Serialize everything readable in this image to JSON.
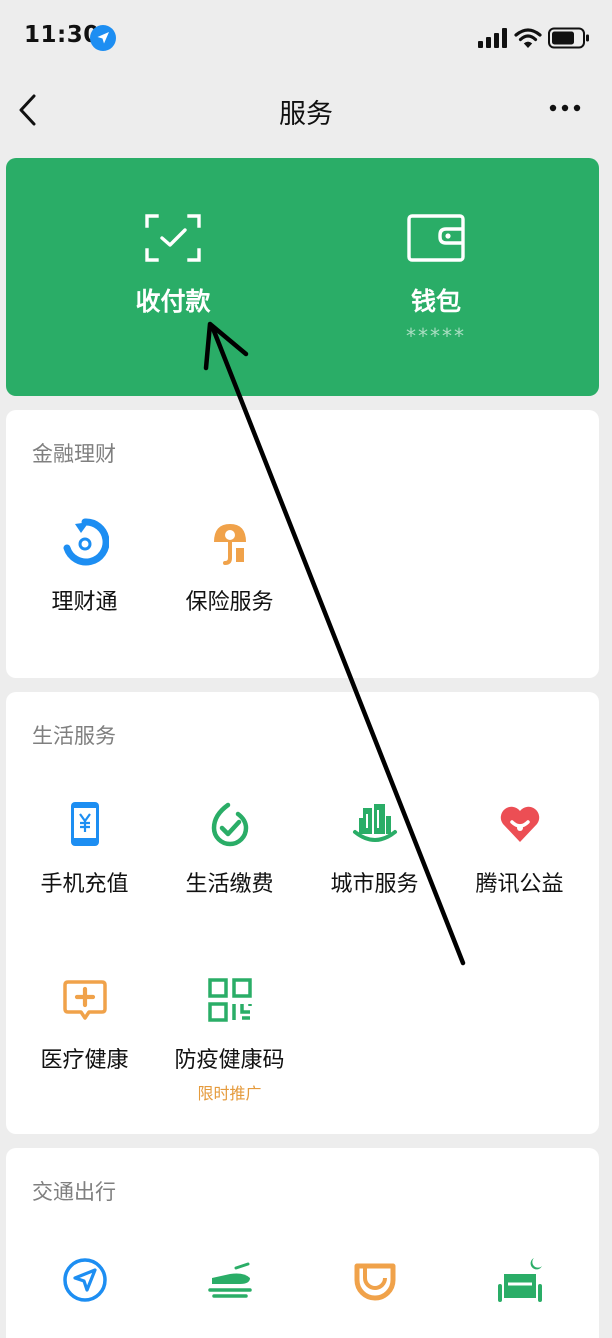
{
  "status_bar": {
    "time": "11:30"
  },
  "nav": {
    "title": "服务"
  },
  "wallet_card": {
    "pay": {
      "label": "收付款"
    },
    "wallet": {
      "label": "钱包",
      "balance_mask": "*****"
    }
  },
  "sections": {
    "finance": {
      "title": "金融理财",
      "items": [
        {
          "label": "理财通"
        },
        {
          "label": "保险服务"
        }
      ]
    },
    "life": {
      "title": "生活服务",
      "items": [
        {
          "label": "手机充值"
        },
        {
          "label": "生活缴费"
        },
        {
          "label": "城市服务"
        },
        {
          "label": "腾讯公益"
        },
        {
          "label": "医疗健康"
        },
        {
          "label": "防疫健康码",
          "badge": "限时推广"
        }
      ]
    },
    "transport": {
      "title": "交通出行"
    }
  },
  "colors": {
    "brand_green": "#2aad67",
    "icon_blue": "#1d8ef2",
    "icon_orange": "#f0a24a",
    "icon_green": "#2aad67",
    "icon_red": "#ec4e54",
    "badge_orange": "#e59b3d"
  }
}
